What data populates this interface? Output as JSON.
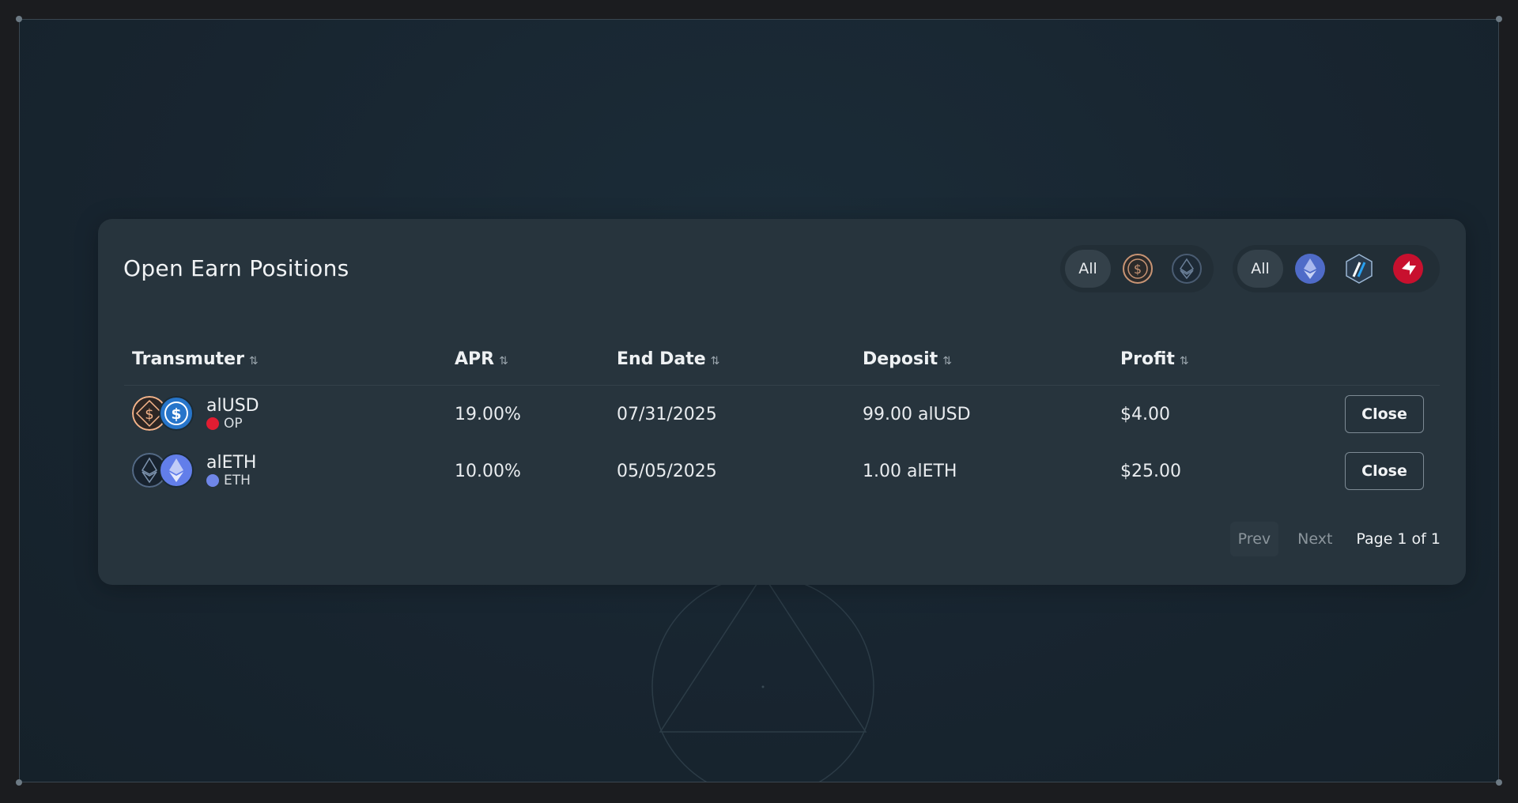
{
  "panel": {
    "title": "Open Earn Positions",
    "token_filter": {
      "all_label": "All",
      "icons": [
        "alusd-icon",
        "aleth-icon"
      ]
    },
    "chain_filter": {
      "all_label": "All",
      "icons": [
        "ethereum-icon",
        "arbitrum-icon",
        "optimism-icon"
      ]
    }
  },
  "table": {
    "columns": [
      {
        "label": "Transmuter",
        "sort_icon": "⇅"
      },
      {
        "label": "APR",
        "sort_icon": "⇅"
      },
      {
        "label": "End Date",
        "sort_icon": "⇅"
      },
      {
        "label": "Deposit",
        "sort_icon": "⇅"
      },
      {
        "label": "Profit",
        "sort_icon": "⇅"
      }
    ],
    "rows": [
      {
        "token": "alUSD",
        "chain": "OP",
        "apr": "19.00%",
        "end_date": "07/31/2025",
        "deposit": "99.00 alUSD",
        "profit": "$4.00",
        "action": "Close"
      },
      {
        "token": "alETH",
        "chain": "ETH",
        "apr": "10.00%",
        "end_date": "05/05/2025",
        "deposit": "1.00 alETH",
        "profit": "$25.00",
        "action": "Close"
      }
    ]
  },
  "pagination": {
    "prev_label": "Prev",
    "next_label": "Next",
    "page_info": "Page 1 of 1"
  },
  "colors": {
    "card_bg": "#27343d",
    "background": "#182530",
    "alusd_orange": "#f5b48a",
    "usdc_blue": "#2775ca",
    "eth_purple": "#627eea",
    "optimism_red": "#ff0420"
  }
}
